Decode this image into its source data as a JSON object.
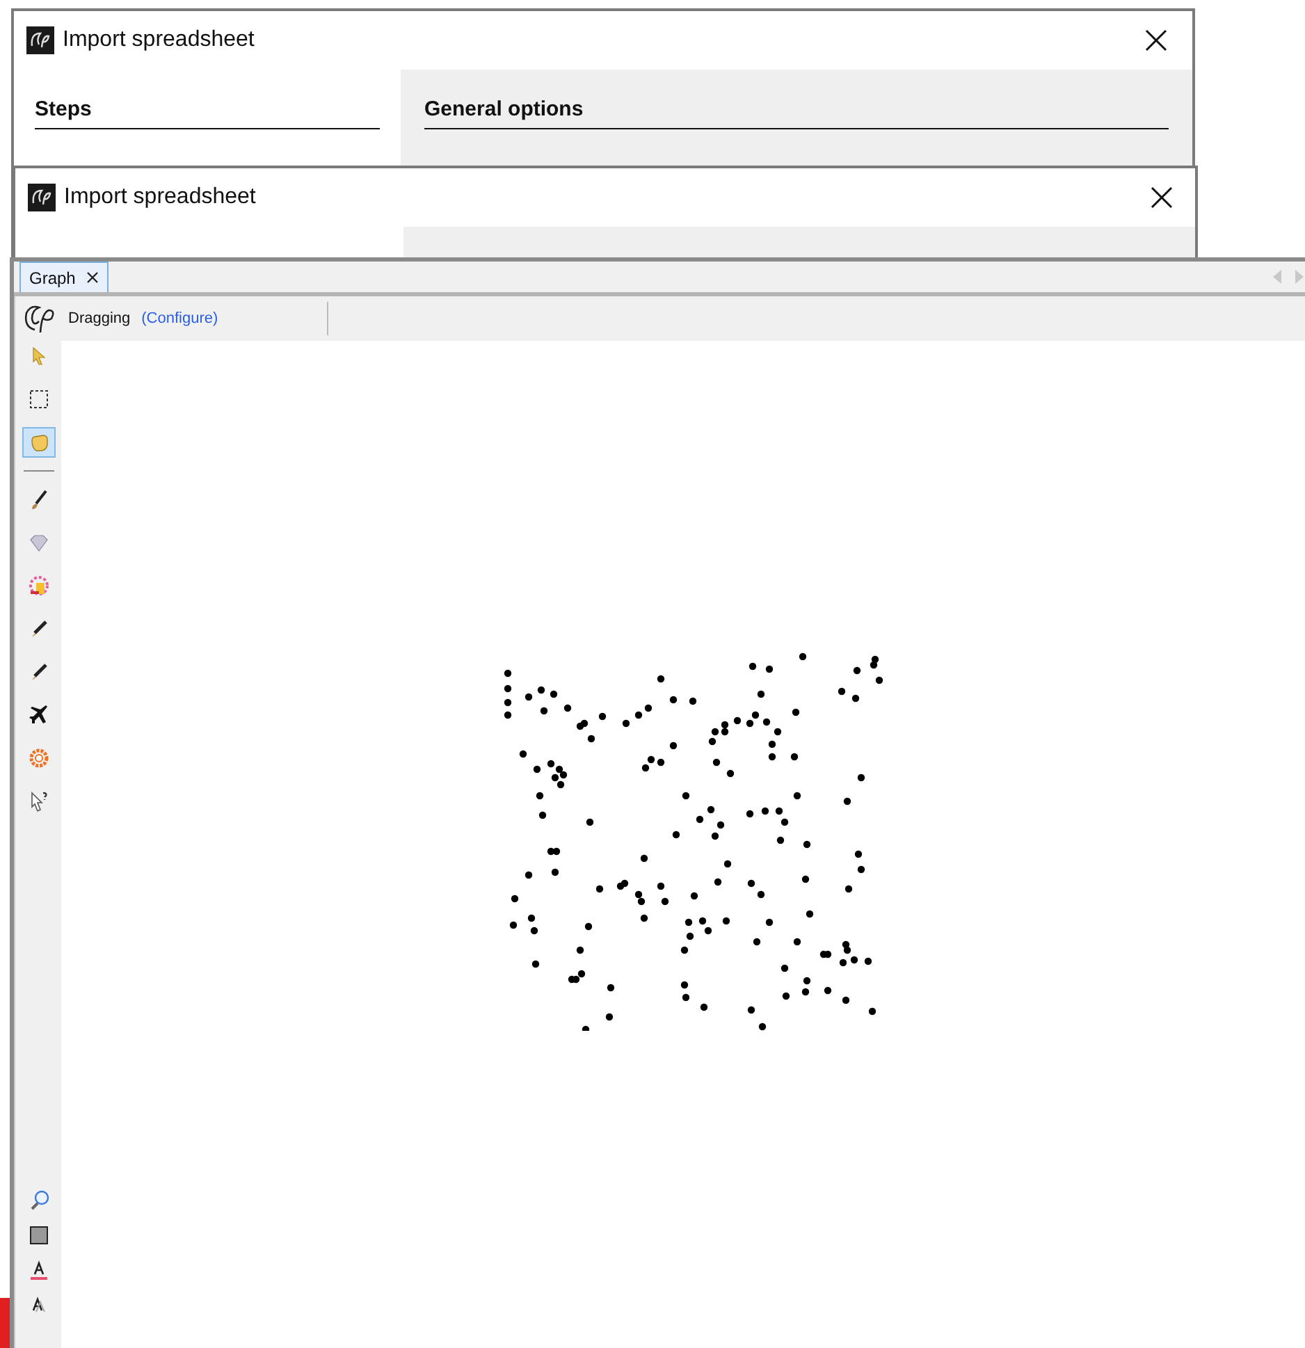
{
  "windows": [
    {
      "title": "Import spreadsheet",
      "steps_heading": "Steps",
      "panel_heading": "General options"
    },
    {
      "title": "Import spreadsheet"
    }
  ],
  "graph": {
    "tabs": [
      {
        "label": "Graph",
        "selected": true
      }
    ],
    "mode": "Dragging",
    "configure_link": "(Configure)",
    "tools": [
      {
        "kind": "select",
        "selected": false
      },
      {
        "kind": "marquee",
        "selected": false
      },
      {
        "kind": "hand",
        "selected": true
      },
      {
        "kind": "separator"
      },
      {
        "kind": "brush",
        "selected": false
      },
      {
        "kind": "diamond",
        "selected": false
      },
      {
        "kind": "palette",
        "selected": false
      },
      {
        "kind": "pencil",
        "selected": false
      },
      {
        "kind": "pencil",
        "selected": false
      },
      {
        "kind": "plane",
        "selected": false
      },
      {
        "kind": "sun",
        "selected": false
      },
      {
        "kind": "help",
        "selected": false
      }
    ],
    "bottom_tools": [
      {
        "kind": "zoom"
      },
      {
        "kind": "square"
      },
      {
        "kind": "text-color"
      },
      {
        "kind": "text-style"
      }
    ]
  }
}
